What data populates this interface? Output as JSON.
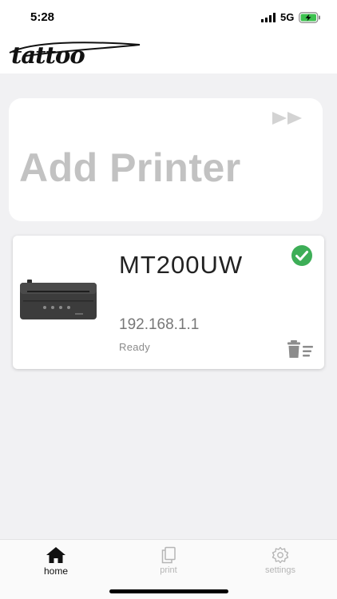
{
  "status_bar": {
    "time": "5:28",
    "network": "5G"
  },
  "header": {
    "logo_text": "tattoo"
  },
  "add_printer": {
    "label": "Add Printer"
  },
  "printer": {
    "name": "MT200UW",
    "ip": "192.168.1.1",
    "status": "Ready",
    "connected": true
  },
  "tabs": [
    {
      "label": "home",
      "icon": "home-icon",
      "active": true
    },
    {
      "label": "print",
      "icon": "print-icon",
      "active": false
    },
    {
      "label": "settings",
      "icon": "settings-icon",
      "active": false
    }
  ],
  "colors": {
    "connected": "#3dae57",
    "inactive_tab": "#b5b5b5",
    "active_tab": "#111111"
  }
}
